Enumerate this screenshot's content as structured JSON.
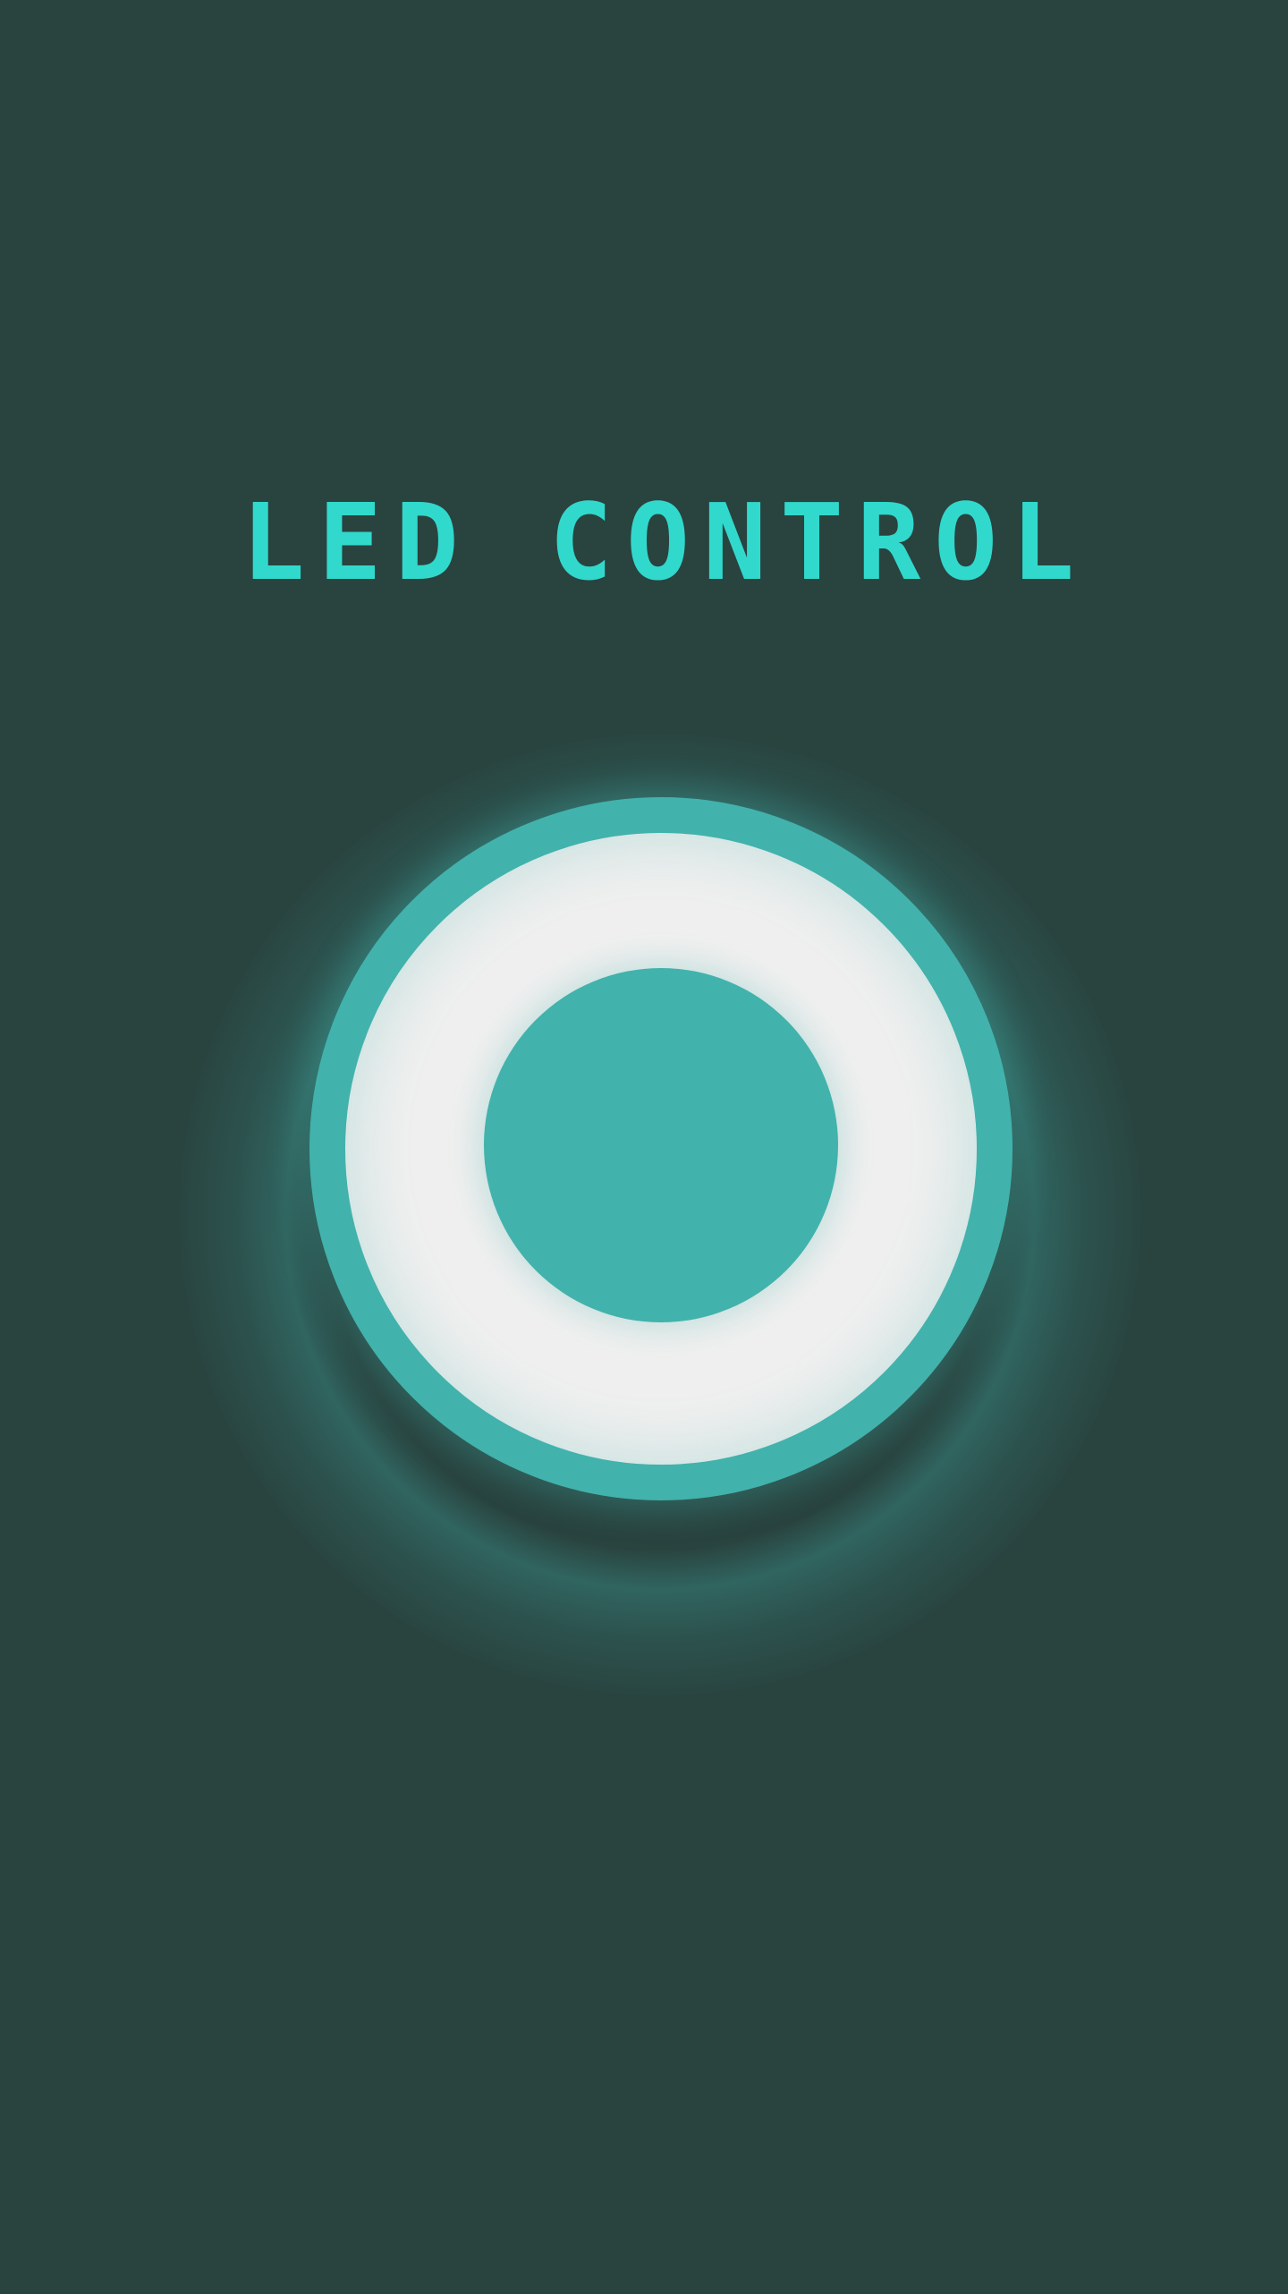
{
  "app": {
    "title": "LED CONTROL"
  },
  "colors": {
    "background": "#29433f",
    "title": "#31d9cc",
    "led": "#42b2ac"
  },
  "controls": {
    "power_button_icon": "led-power-icon"
  }
}
